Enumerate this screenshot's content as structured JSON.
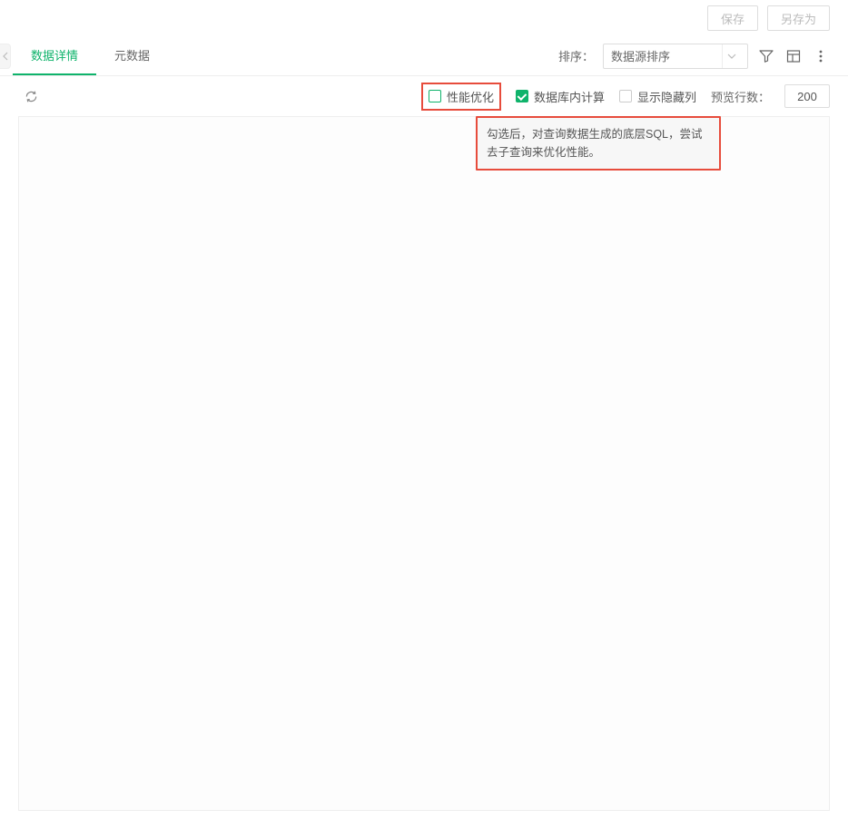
{
  "toolbar": {
    "save_label": "保存",
    "save_as_label": "另存为"
  },
  "tabs": {
    "data_detail": "数据详情",
    "metadata": "元数据"
  },
  "sort": {
    "label": "排序：",
    "selected": "数据源排序"
  },
  "options": {
    "perf_opt_label": "性能优化",
    "db_compute_label": "数据库内计算",
    "show_hidden_label": "显示隐藏列",
    "preview_rows_label": "预览行数：",
    "preview_rows_value": "200"
  },
  "tooltip": {
    "text": "勾选后，对查询数据生成的底层SQL，尝试去子查询来优化性能。"
  }
}
